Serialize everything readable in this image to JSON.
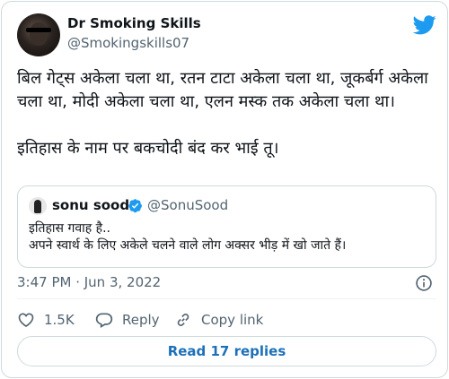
{
  "author": {
    "name": "Dr Smoking Skills",
    "handle": "@Smokingskills07",
    "avatar_icon": "user-avatar-photo"
  },
  "platform_icon": "twitter-bird-icon",
  "tweet": {
    "text": "बिल गेट्स अकेला चला था, रतन टाटा अकेला चला था, जूकर्बर्ग अकेला चला था, मोदी अकेला चला था, एलन मस्क तक अकेला चला था।\n\nइतिहास के नाम पर बकचोदी बंद कर भाई तू।"
  },
  "quoted_tweet": {
    "name": "sonu sood",
    "handle": "@SonuSood",
    "verified": true,
    "text": "इतिहास गवाह है..\nअपने स्वार्थ के लिए अकेले चलने वाले लोग अक्सर भीड़ में खो जाते हैं।"
  },
  "timestamp": "3:47 PM · Jun 3, 2022",
  "actions": {
    "like_count": "1.5K",
    "reply_label": "Reply",
    "copy_link_label": "Copy link"
  },
  "read_replies_label": "Read 17 replies",
  "colors": {
    "twitter_blue": "#1d9bf0",
    "link_blue": "#1d70b8",
    "secondary_text": "#536471",
    "border": "#cfd9de"
  }
}
